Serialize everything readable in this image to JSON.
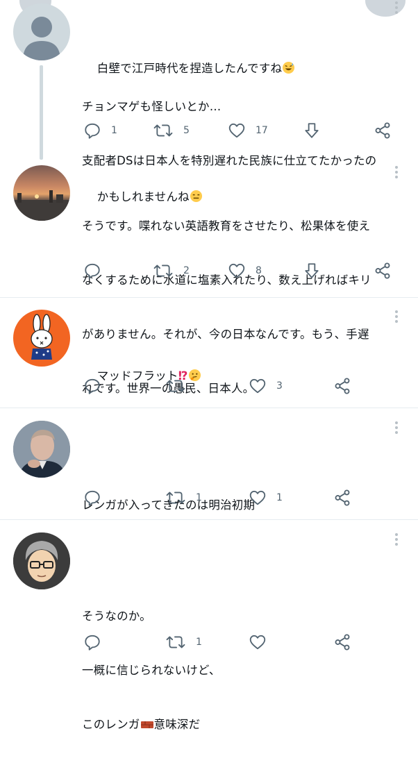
{
  "posts": [
    {
      "lines": [
        "白壁で江戸時代を捏造したんですね",
        "チョンマゲも怪しいとか…",
        "支配者DSは日本人を特別遅れた民族に仕立てたかったの",
        "かもしれませんね"
      ],
      "replies": "1",
      "retweets": "5",
      "likes": "17"
    },
    {
      "lines": [
        "そうです。喋れない英語教育をさせたり、松果体を使え",
        "なくするために水道に塩素入れたり、数え上げればキリ",
        "がありません。それが、今の日本なんです。もう、手遅",
        "れです。世界一の愚民、日本人。"
      ],
      "replies": "",
      "retweets": "2",
      "likes": "8"
    },
    {
      "lines": [
        "マッドフラット"
      ],
      "replies": "",
      "retweets": "",
      "likes": "3"
    },
    {
      "lines": [
        "レンガが入ってきたのは明治初期"
      ],
      "replies": "",
      "retweets": "1",
      "likes": "1"
    },
    {
      "lines": [
        "そうなのか。",
        "一概に信じられないけど、",
        "このレンガ",
        "意味深だ"
      ],
      "replies": "",
      "retweets": "1",
      "likes": ""
    }
  ],
  "colors": {
    "icon": "#536471",
    "thread_line": "#cfd9de",
    "divider": "#e6ecf0"
  }
}
